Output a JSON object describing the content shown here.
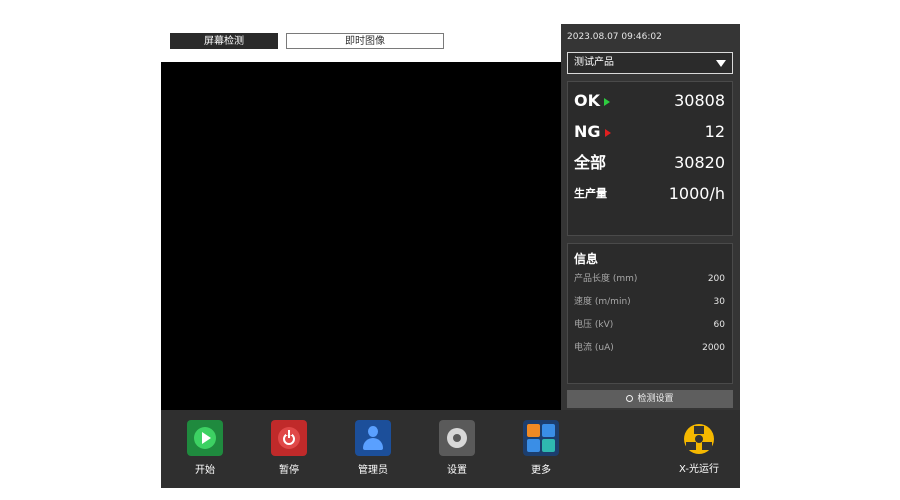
{
  "tabs": {
    "screen_detect": "屏幕检测",
    "realtime_image": "即时图像"
  },
  "status": {
    "datetime": "2023.08.07  09:46:02"
  },
  "product_select": {
    "value": "测试产品"
  },
  "stats": {
    "ok_label": "OK",
    "ok_value": "30808",
    "ng_label": "NG",
    "ng_value": "12",
    "total_label": "全部",
    "total_value": "30820",
    "throughput_label": "生产量",
    "throughput_value": "1000/h"
  },
  "info": {
    "title": "信息",
    "rows": [
      {
        "label": "产品长度 (mm)",
        "value": "200"
      },
      {
        "label": "速度 (m/min)",
        "value": "30"
      },
      {
        "label": "电压 (kV)",
        "value": "60"
      },
      {
        "label": "电流 (uA)",
        "value": "2000"
      }
    ]
  },
  "detect_settings_label": "检测设置",
  "toolbar": {
    "start": "开始",
    "pause": "暂停",
    "admin": "管理员",
    "settings": "设置",
    "more": "更多",
    "xray": "X-光运行"
  },
  "colors": {
    "ok": "#2ecc40",
    "ng": "#e02020",
    "panel": "#2b2b2b",
    "xray": "#f5b800"
  }
}
